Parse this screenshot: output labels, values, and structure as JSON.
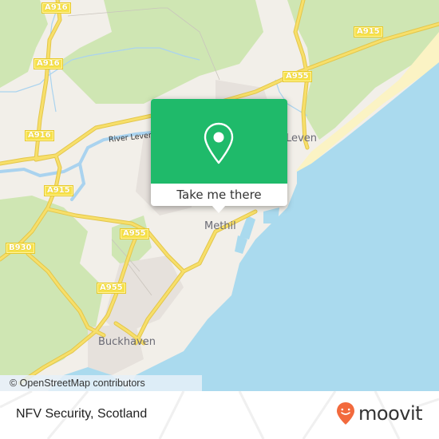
{
  "map": {
    "colors": {
      "land": "#f2efe9",
      "woodland": "#cfe6b3",
      "urban": "#e6e1dc",
      "water": "#aadaee",
      "beach": "#fbf3c4",
      "road": "#f7df6a",
      "road_outline": "#e3c64a",
      "river": "#aad3ef"
    },
    "road_labels": [
      {
        "id": "a916-top",
        "text": "A916"
      },
      {
        "id": "a916-mid",
        "text": "A916"
      },
      {
        "id": "a916-low",
        "text": "A916"
      },
      {
        "id": "a915-east",
        "text": "A915"
      },
      {
        "id": "a955-north",
        "text": "A955"
      },
      {
        "id": "a915-west",
        "text": "A915"
      },
      {
        "id": "a955-center",
        "text": "A955"
      },
      {
        "id": "b930",
        "text": "B930"
      },
      {
        "id": "a955-south",
        "text": "A955"
      }
    ],
    "place_labels": {
      "leven": "Leven",
      "methil": "Methil",
      "buckhaven": "Buckhaven"
    },
    "water_labels": {
      "river_leven": "River Leven"
    },
    "attribution": "© OpenStreetMap contributors"
  },
  "popup": {
    "icon": "location-pin-icon",
    "accent": "#1fba6a",
    "cta_label": "Take me there"
  },
  "footer": {
    "title": "NFV Security, Scotland",
    "brand": "moovit",
    "brand_color": "#f26a3d"
  }
}
